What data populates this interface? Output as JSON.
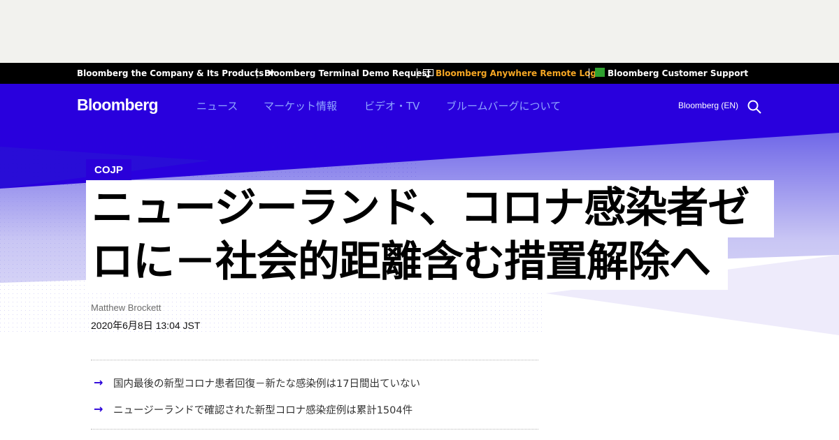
{
  "topbar": {
    "company_label": "Bloomberg the Company & Its Products",
    "terminal_demo_label": "Bloomberg Terminal Demo Request",
    "anywhere_label": "Bloomberg Anywhere Remote Login",
    "support_label": "Bloomberg Customer Support",
    "anywhere_color": "#f5a623"
  },
  "nav": {
    "logo": "Bloomberg",
    "links": [
      "ニュース",
      "マーケット情報",
      "ビデオ・TV",
      "ブルームバーグについて"
    ],
    "region": "Bloomberg (EN)",
    "link_color": "#8fa6ff"
  },
  "article": {
    "kicker": "COJP",
    "headline_line1": "ニュージーランド、コロナ感染者ゼ",
    "headline_line2": "ロに－社会的距離含む措置解除へ",
    "author": "Matthew Brockett",
    "date": "2020年6月8日 13:04 JST",
    "abstract": [
      "国内最後の新型コロナ患者回復－新たな感染例は17日間出ていない",
      "ニュージーランドで確認された新型コロナ感染症例は累計1504件"
    ]
  },
  "icons": {
    "abstract_arrow": "→",
    "search": "search-icon",
    "dropdown": "chevron-down-icon"
  },
  "colors": {
    "brand_blue": "#2a00d9",
    "hero_background": "#2900dd",
    "topbar_background": "#000000"
  }
}
